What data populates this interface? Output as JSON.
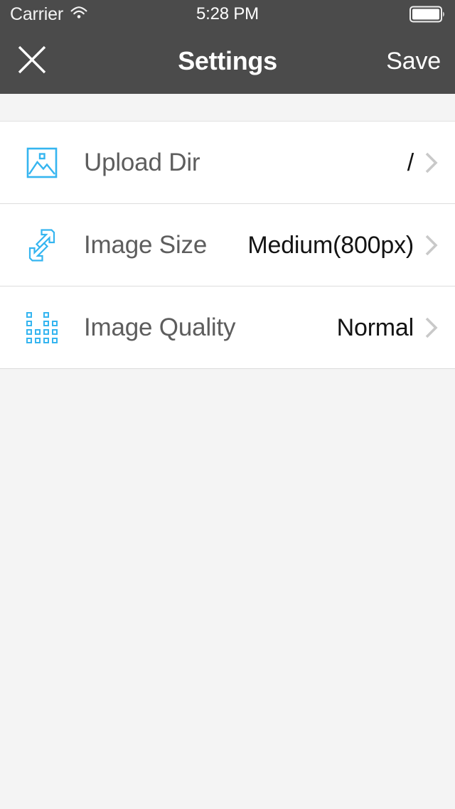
{
  "status_bar": {
    "carrier": "Carrier",
    "wifi_icon": "wifi-icon",
    "time": "5:28 PM",
    "battery_icon": "battery-full-icon"
  },
  "nav_bar": {
    "close_icon": "close-icon",
    "title": "Settings",
    "save_label": "Save"
  },
  "colors": {
    "nav_background": "#4b4b4b",
    "accent_icon": "#35b5f0",
    "label_text": "#5d5d5d",
    "value_text": "#131313",
    "chevron": "#c9c9c9",
    "page_background": "#f4f4f4",
    "row_background": "#ffffff",
    "divider": "#dcdcdc"
  },
  "settings": {
    "rows": [
      {
        "icon": "image-picture-icon",
        "label": "Upload Dir",
        "value": "/",
        "chevron": "chevron-right-icon"
      },
      {
        "icon": "resize-arrows-icon",
        "label": "Image Size",
        "value": "Medium(800px)",
        "chevron": "chevron-right-icon"
      },
      {
        "icon": "dot-matrix-quality-icon",
        "label": "Image Quality",
        "value": "Normal",
        "chevron": "chevron-right-icon"
      }
    ]
  }
}
